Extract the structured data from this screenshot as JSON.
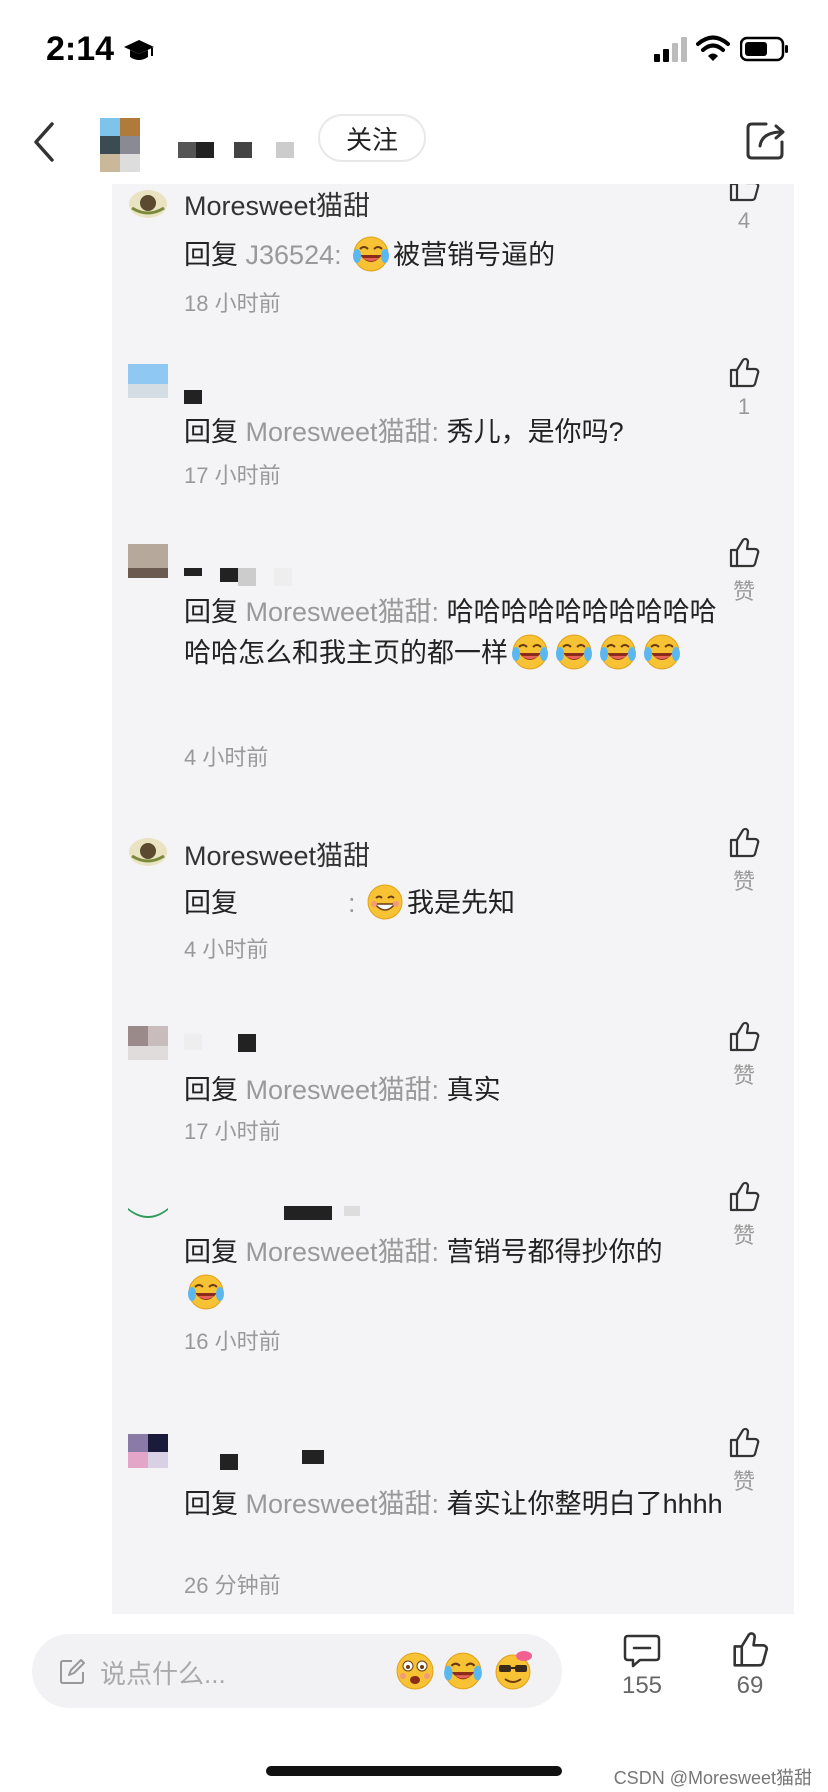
{
  "status_bar": {
    "time": "2:14"
  },
  "header": {
    "follow_label": "关注"
  },
  "comments": [
    {
      "username": "Moresweet猫甜",
      "reply_word": "回复 ",
      "target": "J36524:",
      "text": "被营销号逼的",
      "time": "18 小时前",
      "likes": "4"
    },
    {
      "username": "",
      "reply_word": "回复 ",
      "target": "Moresweet猫甜:",
      "text": "秀儿，是你吗?",
      "time": "17 小时前",
      "likes": "1"
    },
    {
      "username": "",
      "reply_word": "回复 ",
      "target": "Moresweet猫甜:",
      "text": "哈哈哈哈哈哈哈哈哈哈哈哈怎么和我主页的都一样",
      "time": "4 小时前",
      "likes": "赞"
    },
    {
      "username": "Moresweet猫甜",
      "reply_word": "回复",
      "target": ":",
      "text": "我是先知",
      "time": "4 小时前",
      "likes": "赞"
    },
    {
      "username": "",
      "reply_word": "回复 ",
      "target": "Moresweet猫甜:",
      "text": "真实",
      "time": "17 小时前",
      "likes": "赞"
    },
    {
      "username": "",
      "reply_word": "回复 ",
      "target": "Moresweet猫甜:",
      "text": "营销号都得抄你的",
      "time": "16 小时前",
      "likes": "赞"
    },
    {
      "username": "",
      "reply_word": "回复 ",
      "target": "Moresweet猫甜:",
      "text": "着实让你整明白了hhhh",
      "time": "26 分钟前",
      "likes": "赞"
    }
  ],
  "bottom_bar": {
    "placeholder": "说点什么...",
    "comment_count": "155",
    "like_count": "69",
    "watermark": "CSDN @Moresweet猫甜"
  },
  "colors": {
    "panel_bg": "#f4f4f6",
    "secondary_text": "#999999"
  },
  "icons": [
    "graduation-cap-icon",
    "signal-icon",
    "wifi-icon",
    "battery-icon",
    "back-icon",
    "share-icon",
    "thumbs-up-icon",
    "edit-icon",
    "comment-icon",
    "laugh-cry-emoji",
    "grin-emoji",
    "cool-emoji",
    "surprised-emoji"
  ]
}
